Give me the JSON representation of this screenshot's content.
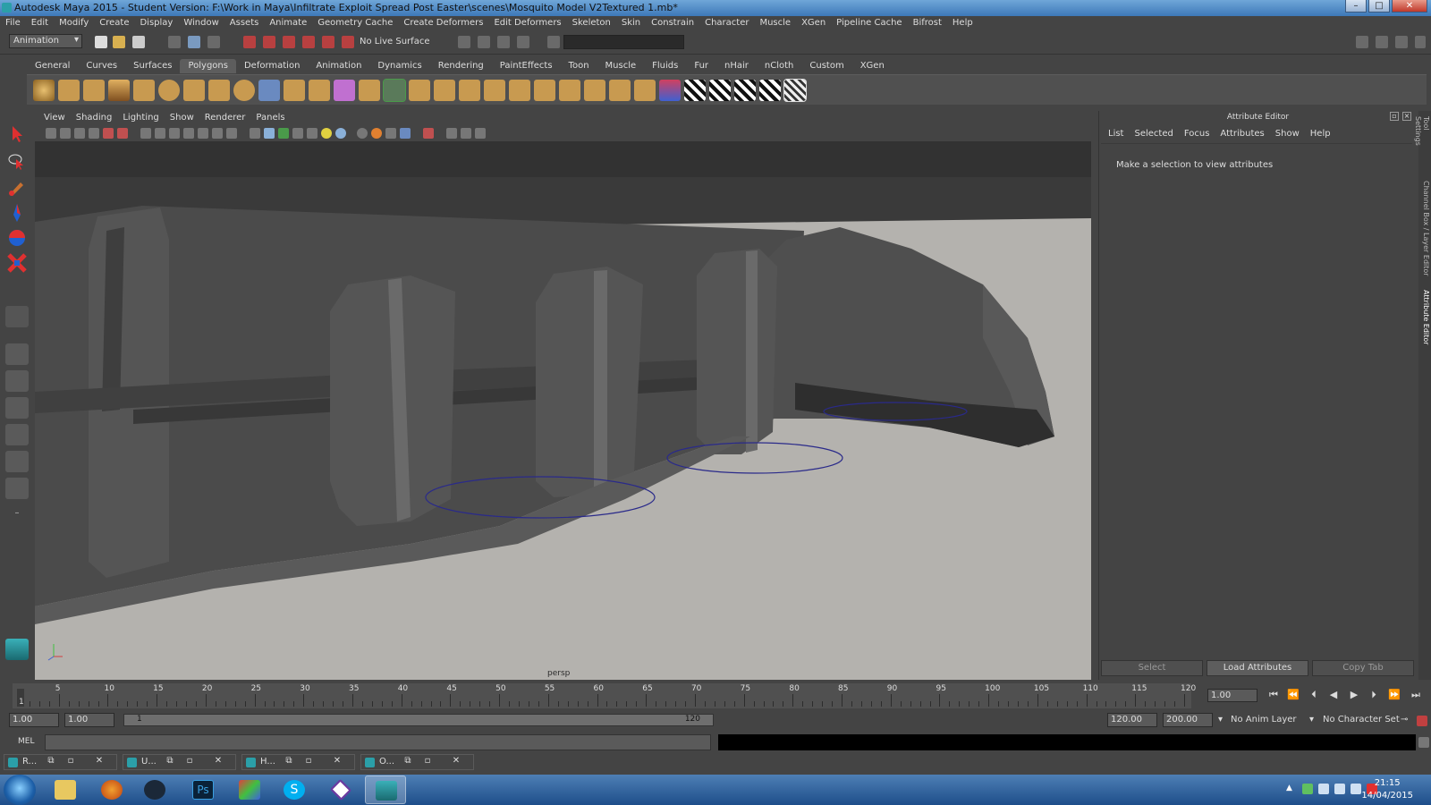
{
  "window": {
    "title": "Autodesk Maya 2015 - Student Version: F:\\Work in Maya\\Infiltrate Exploit Spread Post Easter\\scenes\\Mosquito Model V2Textured 1.mb*",
    "controls": [
      "–",
      "□",
      "✕"
    ]
  },
  "menubar": [
    "File",
    "Edit",
    "Modify",
    "Create",
    "Display",
    "Window",
    "Assets",
    "Animate",
    "Geometry Cache",
    "Create Deformers",
    "Edit Deformers",
    "Skeleton",
    "Skin",
    "Constrain",
    "Character",
    "Muscle",
    "XGen",
    "Pipeline Cache",
    "Bifrost",
    "Help"
  ],
  "statusline": {
    "mode": "Animation",
    "live_surface": "No Live Surface"
  },
  "shelf": {
    "tabs": [
      "General",
      "Curves",
      "Surfaces",
      "Polygons",
      "Deformation",
      "Animation",
      "Dynamics",
      "Rendering",
      "PaintEffects",
      "Toon",
      "Muscle",
      "Fluids",
      "Fur",
      "nHair",
      "nCloth",
      "Custom",
      "XGen"
    ],
    "active_tab": "Polygons"
  },
  "viewport": {
    "menu": [
      "View",
      "Shading",
      "Lighting",
      "Show",
      "Renderer",
      "Panels"
    ],
    "camera_label": "persp",
    "background_color": "#b4b2ae",
    "model_color": "#4a4a4a",
    "selection_ring_color": "#2a2a8a"
  },
  "attribute_editor": {
    "title": "Attribute Editor",
    "menu": [
      "List",
      "Selected",
      "Focus",
      "Attributes",
      "Show",
      "Help"
    ],
    "message": "Make a selection to view attributes",
    "buttons": {
      "select": "Select",
      "load": "Load Attributes",
      "copy": "Copy Tab"
    }
  },
  "side_tabs": [
    "Tool Settings",
    "Channel Box / Layer Editor",
    "Attribute Editor"
  ],
  "time_slider": {
    "tick_labels": [
      "5",
      "10",
      "15",
      "20",
      "25",
      "30",
      "35",
      "40",
      "45",
      "50",
      "55",
      "60",
      "65",
      "70",
      "75",
      "80",
      "85",
      "90",
      "95",
      "100",
      "105",
      "110",
      "115",
      "120"
    ],
    "current_marker": "1",
    "current_frame": "1.00"
  },
  "range_slider": {
    "start_time": "1.00",
    "playback_start": "1.00",
    "range_start_label": "1",
    "range_end_label": "120",
    "playback_end": "120.00",
    "end_time": "200.00",
    "anim_layer": "No Anim Layer",
    "character_set": "No Character Set"
  },
  "command_line": {
    "label": "MEL"
  },
  "minimized_windows": [
    {
      "label": "R..."
    },
    {
      "label": "U..."
    },
    {
      "label": "H..."
    },
    {
      "label": "O..."
    }
  ],
  "taskbar": {
    "apps": [
      "Explorer",
      "Firefox",
      "Steam",
      "Photoshop",
      "Unknown",
      "Skype",
      "Visual Studio",
      "Maya"
    ],
    "time": "21:15",
    "date": "14/04/2015"
  }
}
